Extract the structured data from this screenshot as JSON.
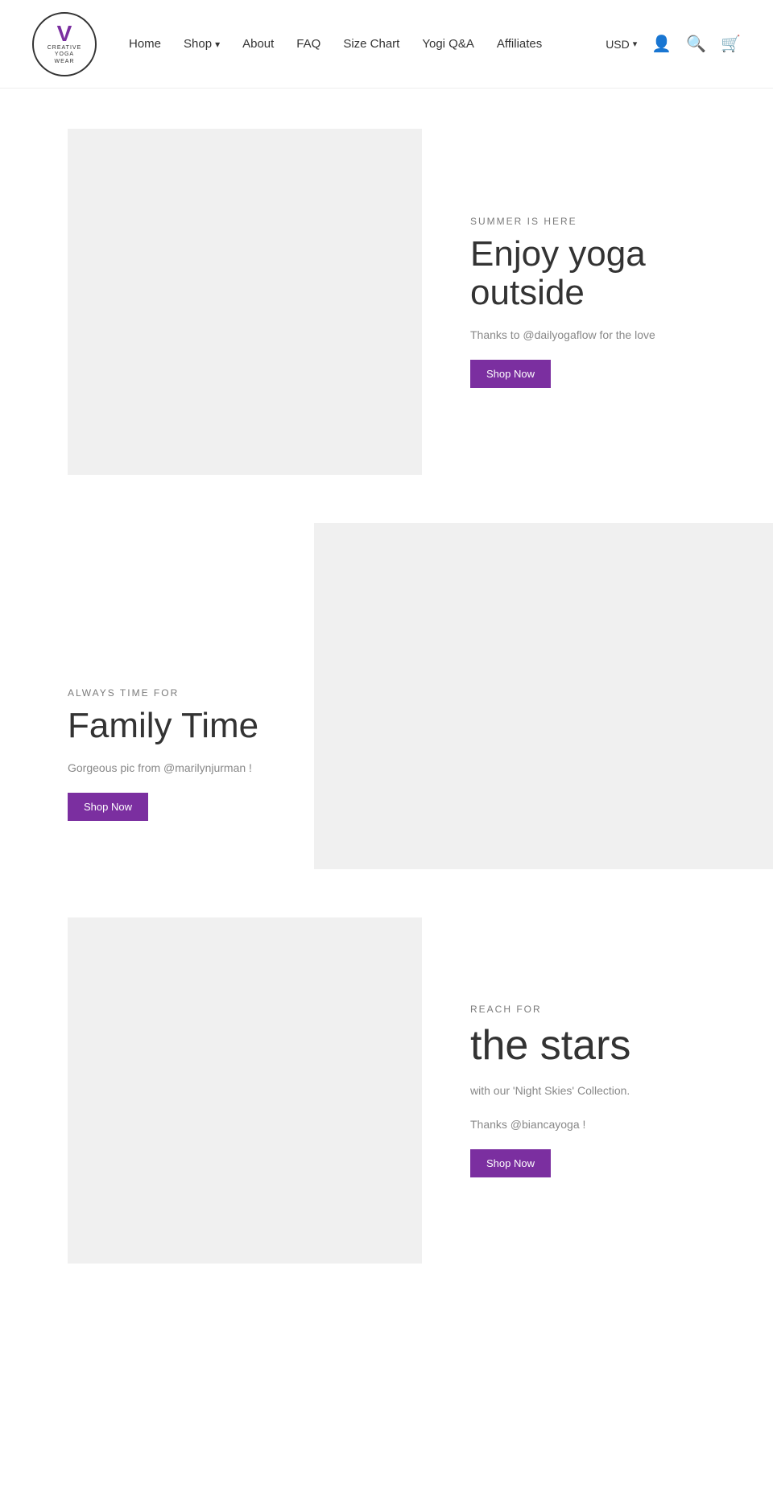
{
  "header": {
    "logo": {
      "v": "V",
      "line1": "CREATIVE",
      "line2": "YOGA",
      "line3": "WEAR"
    },
    "nav": {
      "home": "Home",
      "shop": "Shop",
      "about": "About",
      "faq": "FAQ",
      "size_chart": "Size Chart",
      "yogi_qa": "Yogi Q&A",
      "affiliates": "Affiliates"
    },
    "currency": "USD",
    "account_icon": "👤",
    "search_icon": "🔍",
    "cart_icon": "🛒"
  },
  "sections": [
    {
      "id": "summer",
      "eyebrow": "SUMMER IS HERE",
      "heading": "Enjoy yoga outs...",
      "heading_full": "Enjoy yoga outside",
      "description": "Thanks to @dailyogaflow for the lo...",
      "description_full": "Thanks to @dailyogaflow for the love",
      "btn_label": "Shop Now"
    },
    {
      "id": "family",
      "eyebrow": "ALWAYS TIME FOR",
      "heading": "Family Time",
      "description": "Gorgeous pic from @marilynjurman !",
      "btn_label": "Shop Now"
    },
    {
      "id": "stars",
      "eyebrow": "REACH FOR",
      "heading": "the stars",
      "description": "with our 'Night Skies' Collection.",
      "description2": "Thanks @biancayoga !",
      "btn_label": "Shop Now"
    }
  ],
  "colors": {
    "purple": "#7b2fa0",
    "light_gray": "#f0f0f0",
    "text_dark": "#333",
    "text_gray": "#888",
    "eyebrow_gray": "#7b7b7b"
  }
}
